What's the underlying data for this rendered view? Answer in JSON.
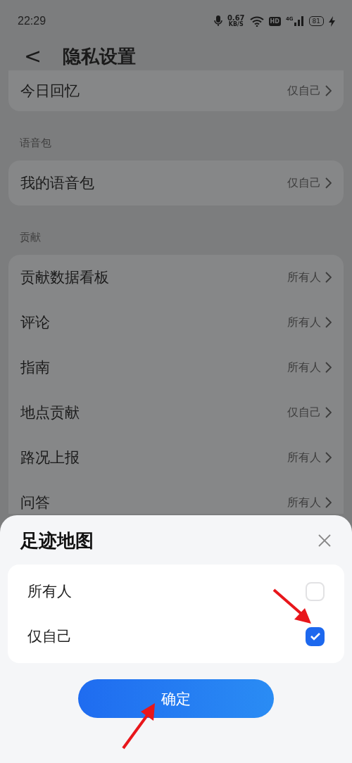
{
  "status_bar": {
    "time": "22:29",
    "speed": "0.67",
    "speed_unit": "KB/S",
    "hd": "HD",
    "network": "4G",
    "battery": "81"
  },
  "header": {
    "back": "<",
    "title": "隐私设置"
  },
  "sections": [
    {
      "rows": [
        {
          "name": "今日回忆",
          "value": "仅自己"
        }
      ]
    },
    {
      "label": "语音包",
      "rows": [
        {
          "name": "我的语音包",
          "value": "仅自己"
        }
      ]
    },
    {
      "label": "贡献",
      "rows": [
        {
          "name": "贡献数据看板",
          "value": "所有人"
        },
        {
          "name": "评论",
          "value": "所有人"
        },
        {
          "name": "指南",
          "value": "所有人"
        },
        {
          "name": "地点贡献",
          "value": "仅自己"
        },
        {
          "name": "路况上报",
          "value": "所有人"
        },
        {
          "name": "问答",
          "value": "所有人"
        }
      ]
    }
  ],
  "sheet": {
    "title": "足迹地图",
    "options": [
      {
        "label": "所有人",
        "selected": false
      },
      {
        "label": "仅自己",
        "selected": true
      }
    ],
    "confirm": "确定"
  }
}
